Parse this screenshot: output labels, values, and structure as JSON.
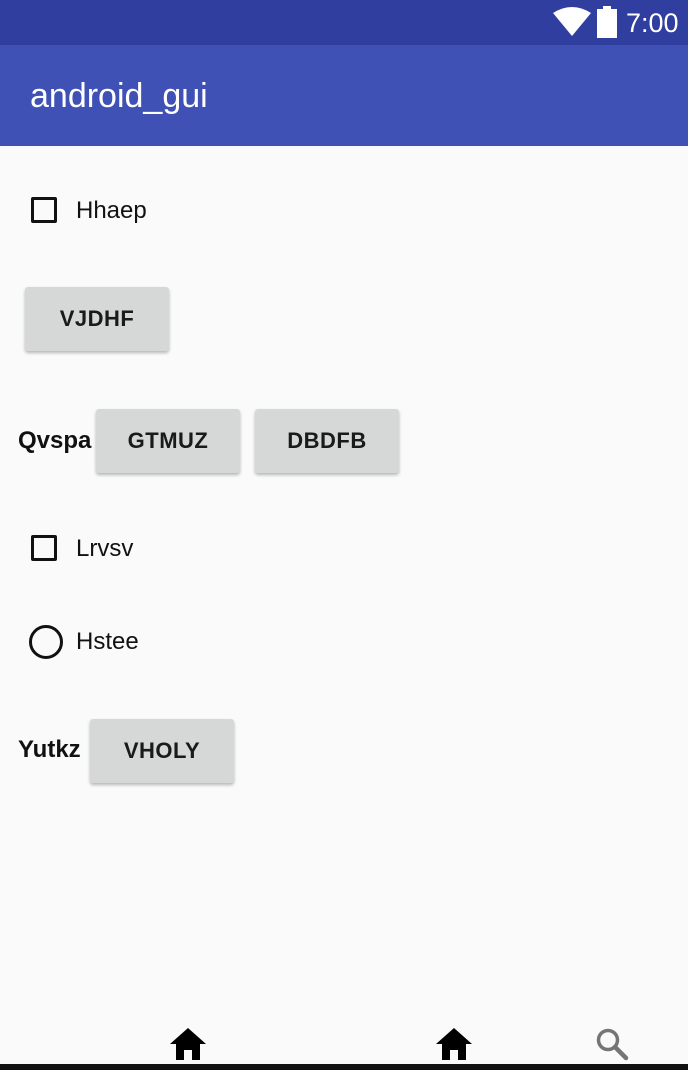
{
  "status_bar": {
    "time": "7:00",
    "wifi_icon": "wifi-icon",
    "battery_icon": "battery-icon",
    "background": "#303f9f"
  },
  "app_bar": {
    "title": "android_gui",
    "background": "#3f51b5"
  },
  "content": {
    "checkbox_1": {
      "label": "Hhaep",
      "checked": false
    },
    "button_vjdhf": "VJDHF",
    "row_qvspa": {
      "label": "Qvspa",
      "button_1": "GTMUZ",
      "button_2": "DBDFB"
    },
    "checkbox_2": {
      "label": "Lrvsv",
      "checked": false
    },
    "radio_1": {
      "label": "Hstee",
      "selected": false
    },
    "row_yutkz": {
      "label": "Yutkz",
      "button": "VHOLY"
    }
  },
  "bottom_nav": {
    "icons": [
      "home-icon",
      "home-icon",
      "search-icon"
    ]
  }
}
